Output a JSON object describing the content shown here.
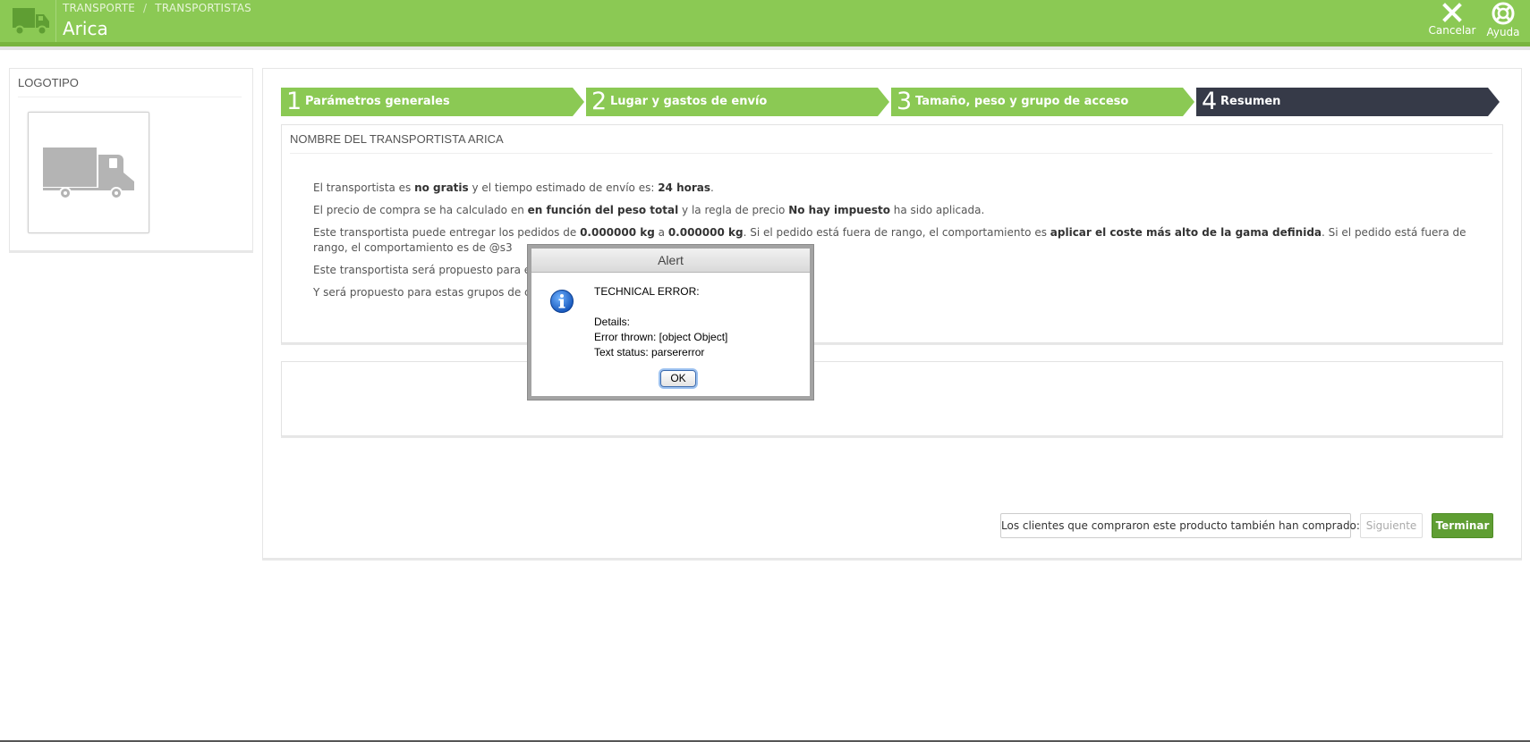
{
  "header": {
    "breadcrumb": [
      "TRANSPORTE",
      "TRANSPORTISTAS"
    ],
    "title": "Arica",
    "actions": {
      "cancel_label": "Cancelar",
      "help_label": "Ayuda"
    },
    "colors": {
      "bar": "#8bc954",
      "stripe": "#78b43e"
    }
  },
  "logo_panel": {
    "heading": "LOGOTIPO",
    "logo_icon": "truck-icon"
  },
  "wizard": {
    "steps": [
      {
        "number": "1",
        "label": "Parámetros generales",
        "state": "done"
      },
      {
        "number": "2",
        "label": "Lugar y gastos de envío",
        "state": "done"
      },
      {
        "number": "3",
        "label": "Tamaño, peso y grupo de acceso",
        "state": "done"
      },
      {
        "number": "4",
        "label": "Resumen",
        "state": "current"
      }
    ],
    "colors": {
      "done": "#8bc954",
      "current": "#363a48"
    }
  },
  "summary": {
    "heading": "NOMBRE DEL TRANSPORTISTA ARICA",
    "line1": {
      "a": "El transportista es ",
      "b": "no gratis",
      "c": " y el tiempo estimado de envío es: ",
      "d": "24 horas",
      "e": "."
    },
    "line2": {
      "a": "El precio de compra se ha calculado en ",
      "b": "en función del peso total",
      "c": " y la regla de precio ",
      "d": "No hay impuesto",
      "e": " ha sido aplicada."
    },
    "line3": {
      "a": "Este transportista puede entregar los pedidos de ",
      "b": "0.000000 kg",
      "c": " a ",
      "d": "0.000000 kg",
      "e": ". Si el pedido está fuera de rango, el comportamiento es ",
      "f": "aplicar el coste más alto de la gama definida",
      "g": ". Si el pedido está fuera de rango, el comportamiento es de @s3"
    },
    "line4": "Este transportista será propuesto para esta",
    "line5": "Y será propuesto para estas grupos de clier"
  },
  "buttons": {
    "back": "Los clientes que compraron este producto también han comprado:",
    "next": "Siguiente",
    "finish": "Terminar"
  },
  "alert": {
    "title": "Alert",
    "icon": "info-icon",
    "lines": [
      "TECHNICAL ERROR:",
      "",
      "Details:",
      "Error thrown: [object Object]",
      "Text status: parsererror"
    ],
    "ok_label": "OK"
  }
}
